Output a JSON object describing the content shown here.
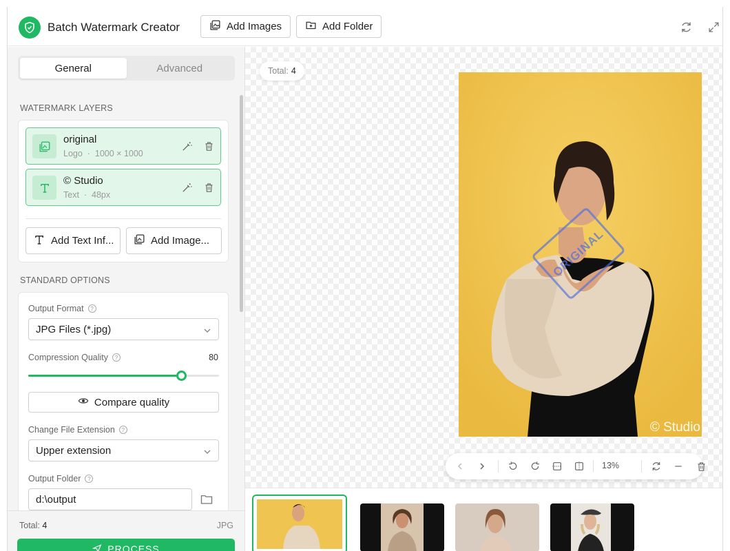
{
  "app": {
    "title": "Batch Watermark Creator",
    "accent": "#21b864"
  },
  "header": {
    "add_images_label": "Add Images",
    "add_folder_label": "Add Folder"
  },
  "sidebar": {
    "tabs": [
      {
        "label": "General",
        "active": true
      },
      {
        "label": "Advanced",
        "active": false
      }
    ],
    "layers_heading": "WATERMARK LAYERS",
    "layers": [
      {
        "name": "original",
        "kind": "Logo",
        "detail": "1000 × 1000",
        "icon": "image-layer-icon"
      },
      {
        "name": "© Studio",
        "kind": "Text",
        "detail": "48px",
        "icon": "text-layer-icon"
      }
    ],
    "separator": "·",
    "add_text_label": "Add Text Inf...",
    "add_image_label": "Add Image...",
    "options_heading": "STANDARD OPTIONS",
    "output_format": {
      "label": "Output Format",
      "value": "JPG Files (*.jpg)"
    },
    "compression": {
      "label": "Compression Quality",
      "value": "80",
      "level": 0.8
    },
    "compare_label": "Compare quality",
    "extension": {
      "label": "Change File Extension",
      "value": "Upper extension"
    },
    "output_folder": {
      "label": "Output Folder",
      "value": "d:\\output"
    }
  },
  "footer": {
    "total_label": "Total:",
    "total_value": "4",
    "format": "JPG",
    "process_label": "PROCESS"
  },
  "main": {
    "total_label": "Total:",
    "total_value": "4",
    "preview_text_watermark": "© Studio",
    "preview_stamp_text": "ORIGINAL",
    "zoom": "13%"
  },
  "thumbnails": [
    {
      "name": "thumb-1",
      "bg": "#f0c451",
      "selected": true
    },
    {
      "name": "thumb-2",
      "bg": "#1a1a1a",
      "selected": false
    },
    {
      "name": "thumb-3",
      "bg": "#d8ccc0",
      "selected": false
    },
    {
      "name": "thumb-4",
      "bg": "#111111",
      "selected": false
    }
  ]
}
